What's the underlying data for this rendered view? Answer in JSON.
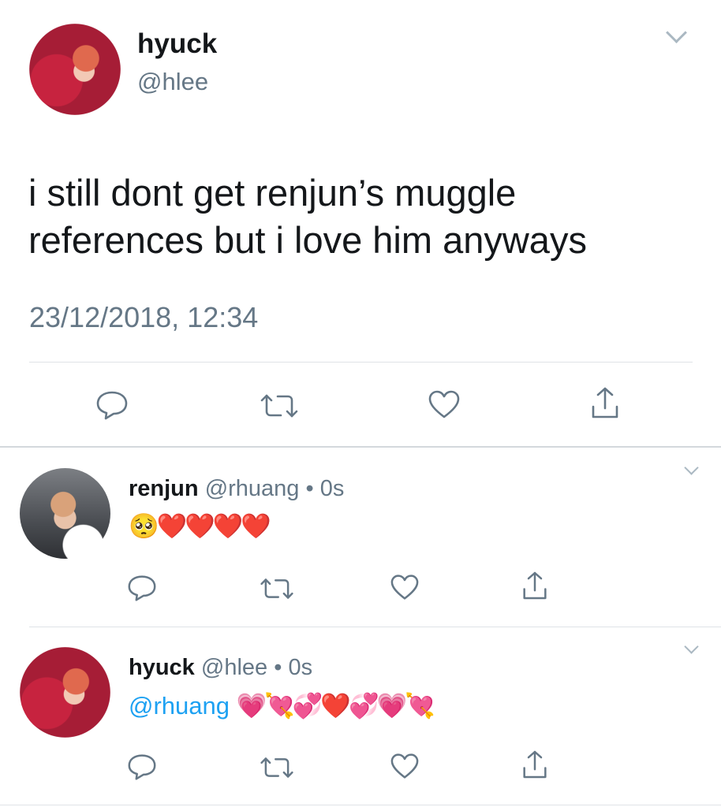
{
  "main_tweet": {
    "display_name": "hyuck",
    "handle": "@hlee",
    "text": "i still dont get renjun’s muggle references but i love him anyways",
    "timestamp": "23/12/2018, 12:34"
  },
  "replies": [
    {
      "display_name": "renjun",
      "handle": "@rhuang",
      "separator": "•",
      "time": "0s",
      "emoji": "🥺❤️❤️❤️❤️"
    },
    {
      "display_name": "hyuck",
      "handle": "@hlee",
      "separator": "•",
      "time": "0s",
      "mention": "@rhuang",
      "emoji": "💗💘💞❤️💞💗💘"
    }
  ],
  "icons": {
    "reply": "reply-icon",
    "retweet": "retweet-icon",
    "like": "heart-icon",
    "share": "share-icon",
    "menu": "chevron-down-icon"
  },
  "colors": {
    "text": "#14171a",
    "secondary": "#657786",
    "icon": "#657786",
    "link": "#1da1f2",
    "divider": "#dfe3e7"
  }
}
